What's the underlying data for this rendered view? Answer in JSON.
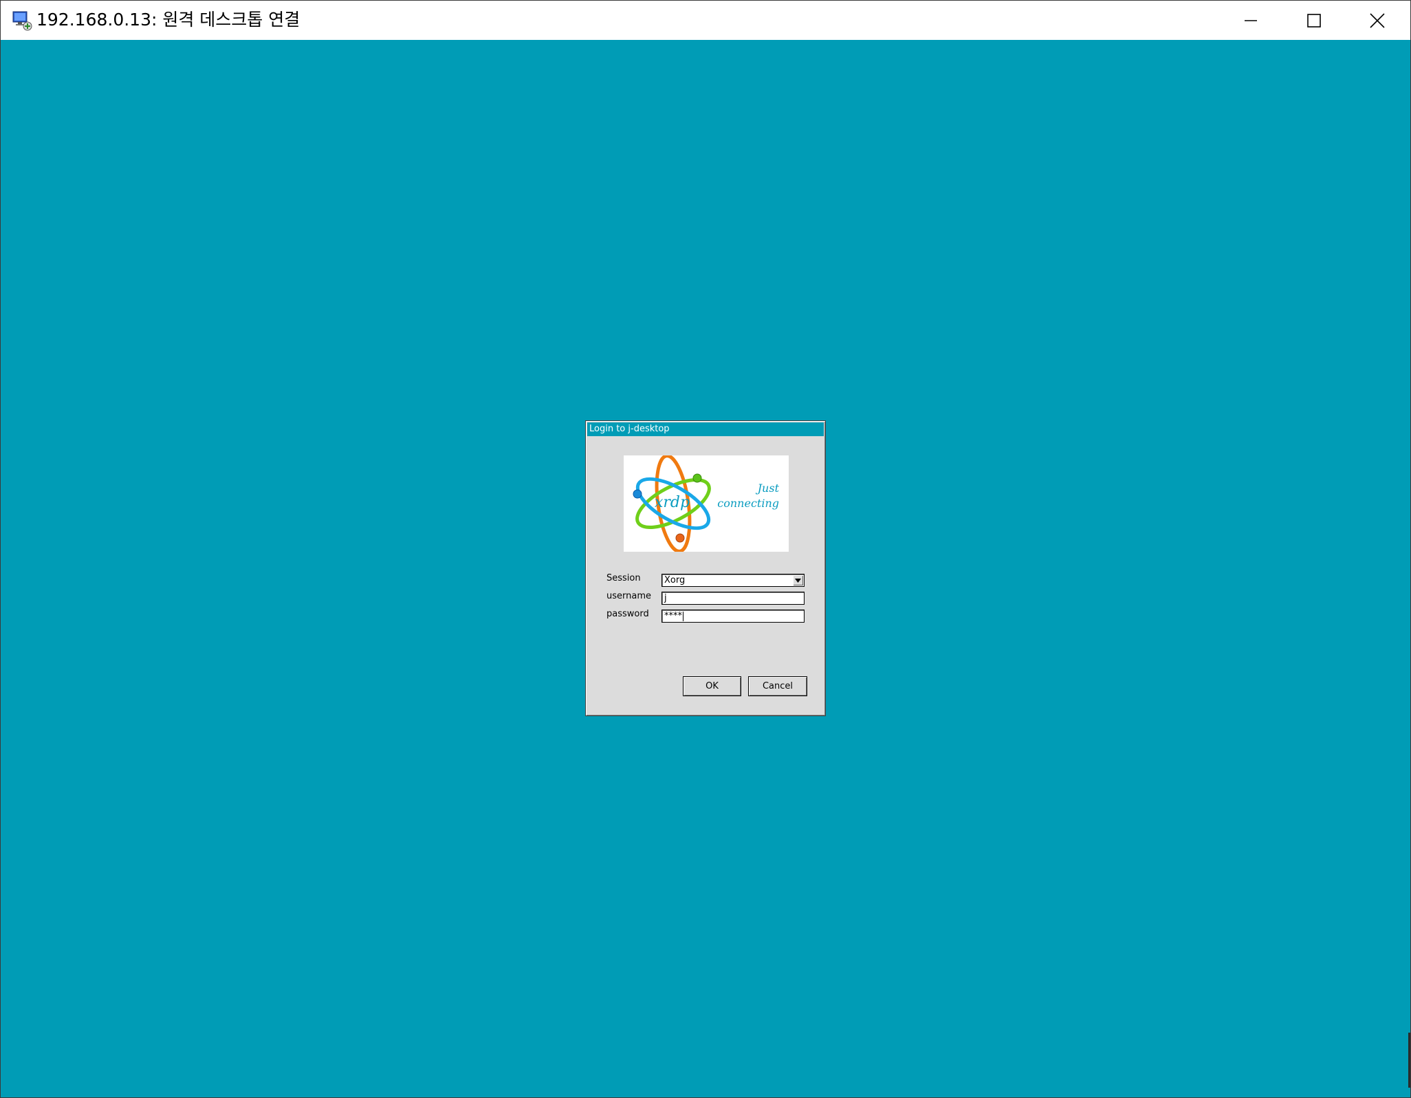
{
  "window": {
    "title": "192.168.0.13: 원격 데스크톱 연결",
    "minimize_icon": "minimize-icon",
    "maximize_icon": "maximize-icon",
    "close_icon": "close-icon",
    "desktop_color": "#009cb6"
  },
  "login": {
    "title": "Login to j-desktop",
    "logo": {
      "name": "xrdp",
      "tagline_line1": "Just",
      "tagline_line2": "connecting"
    },
    "session_label": "Session",
    "session_value": "Xorg",
    "username_label": "username",
    "username_value": "j",
    "password_label": "password",
    "password_value": "****",
    "ok_label": "OK",
    "cancel_label": "Cancel"
  }
}
